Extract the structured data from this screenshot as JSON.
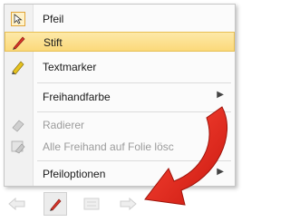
{
  "menu": {
    "items": [
      {
        "label": "Pfeil",
        "icon": "cursor-arrow-icon"
      },
      {
        "label": "Stift",
        "icon": "pen-icon",
        "selected": true
      },
      {
        "label": "Textmarker",
        "icon": "highlighter-icon"
      },
      {
        "label": "Freihandfarbe",
        "submenu": true
      },
      {
        "label": "Radierer",
        "icon": "eraser-icon",
        "disabled": true
      },
      {
        "label": "Alle Freihand auf Folie lösc",
        "icon": "erase-all-icon",
        "disabled": true
      },
      {
        "label": "Pfeiloptionen",
        "submenu": true
      }
    ]
  },
  "colors": {
    "highlight": "#fbd97a",
    "pen_red": "#d9352a",
    "highlighter_yellow": "#e6c21f",
    "annotation_arrow": "#e8281c"
  },
  "toolbar": {
    "buttons": [
      "back-arrow-icon",
      "pen-icon",
      "slides-menu-icon",
      "forward-arrow-icon"
    ]
  }
}
